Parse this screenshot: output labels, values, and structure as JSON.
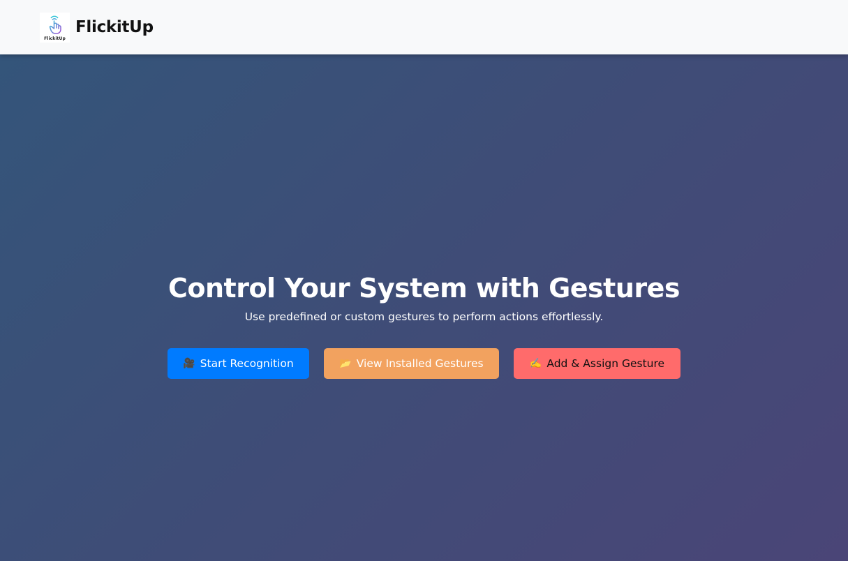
{
  "brand": {
    "name": "FlickitUp",
    "logo_caption": "FlickitUp"
  },
  "hero": {
    "title": "Control Your System with Gestures",
    "subtitle": "Use predefined or custom gestures to perform actions effortlessly."
  },
  "buttons": {
    "start": {
      "icon": "🎥",
      "label": "Start Recognition",
      "color": "#007bff"
    },
    "view": {
      "icon": "📂",
      "label": "View Installed Gestures",
      "color": "#f2a25f"
    },
    "add": {
      "icon": "✍️",
      "label": "Add & Assign Gesture",
      "color": "#ff6b6b"
    }
  },
  "colors": {
    "navbar_bg": "#f8f9fa",
    "hero_gradient_start": "#34557a",
    "hero_gradient_end": "#4a4577"
  }
}
